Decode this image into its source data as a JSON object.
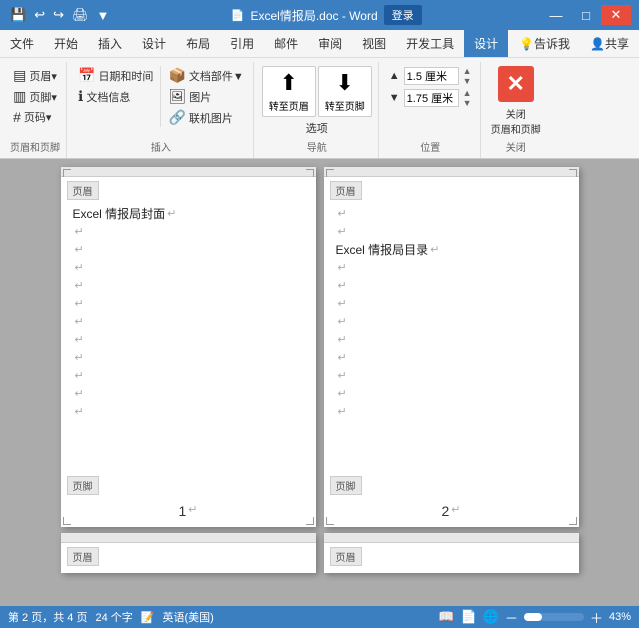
{
  "titlebar": {
    "doc_name": "Excel情报局.doc - Word",
    "page_label": "页",
    "login_label": "登录",
    "minimize": "—",
    "maximize": "□",
    "close": "✕"
  },
  "menu": {
    "items": [
      "文件",
      "开始",
      "插入",
      "设计",
      "布局",
      "引用",
      "邮件",
      "审阅",
      "视图",
      "开发工具",
      "设计"
    ]
  },
  "ribbon": {
    "group1_label": "页眉和页脚",
    "group2_label": "插入",
    "group3_label": "导航",
    "group4_label": "位置",
    "group5_label": "关闭",
    "header_btn": "页眉▼",
    "footer_btn": "页脚▼",
    "page_num_btn": "页码▼",
    "datetime_btn": "日期和时间",
    "doc_info_btn": "文档信息",
    "parts_btn": "文档部件▼",
    "picture_btn": "图片",
    "online_pic_btn": "联机图片",
    "prev_btn": "转至页眉",
    "next_btn": "转至页脚",
    "options_btn": "选项",
    "pos_label1": "1.5 厘米",
    "pos_label2": "1.75 厘米",
    "pos_unit1": "厘米",
    "pos_unit2": "厘米",
    "pos_val1": "1.5",
    "pos_val2": "1.75",
    "close_btn_label": "关闭\n页眉和页脚",
    "tell_me": "告诉我",
    "share": "共享"
  },
  "pages": {
    "page1": {
      "header_label": "页眉",
      "header_title": "Excel 情报局封面↵",
      "lines": [
        "↵",
        "↵",
        "↵",
        "↵",
        "↵",
        "↵",
        "↵",
        "↵",
        "↵",
        "↵",
        "↵"
      ],
      "footer_label": "页脚",
      "page_number": "1↵"
    },
    "page2": {
      "header_label": "页眉",
      "header_extra": "↵",
      "header_title": "Excel 情报局目录↵",
      "lines": [
        "↵",
        "↵",
        "↵",
        "↵",
        "↵",
        "↵",
        "↵",
        "↵",
        "↵",
        "↵"
      ],
      "footer_label": "页脚",
      "page_number": "2↵"
    }
  },
  "partial_pages": {
    "label": "页眉",
    "label2": "页眉"
  },
  "status": {
    "page_info": "第 2 页，共 4 页",
    "word_count": "24 个字",
    "language": "英语(美国)",
    "zoom": "43%"
  }
}
